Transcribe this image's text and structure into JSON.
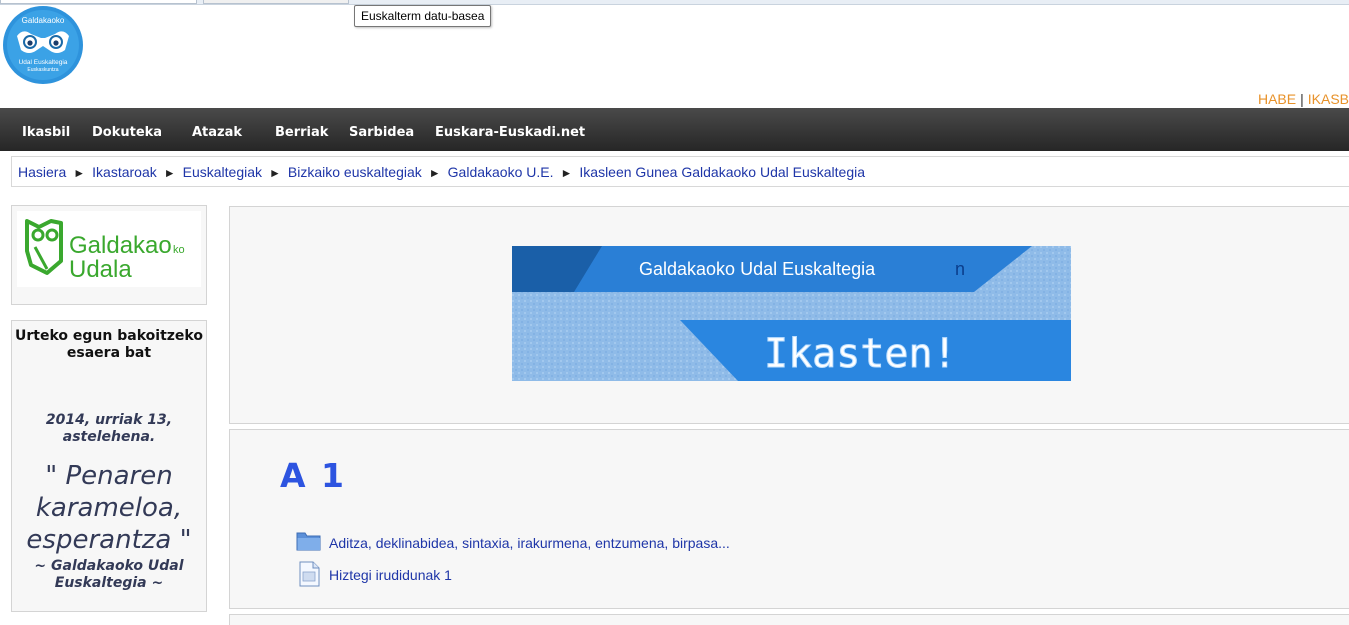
{
  "tooltip": "Euskalterm datu-basea",
  "logo": {
    "lines": [
      "Galdakaoko",
      "Udal Euskaltegia",
      "Euskaskuntza"
    ]
  },
  "top_links": [
    "HABE",
    "IKASB"
  ],
  "nav": [
    "Ikasbil",
    "Dokuteka",
    "Atazak",
    "Berriak",
    "Sarbidea",
    "Euskara-Euskadi.net"
  ],
  "breadcrumb": [
    "Hasiera",
    "Ikastaroak",
    "Euskaltegiak",
    "Bizkaiko euskaltegiak",
    "Galdakaoko U.E.",
    "Ikasleen Gunea Galdakaoko Udal Euskaltegia"
  ],
  "sidebar": {
    "town_logo": {
      "line1": "Galdakao",
      "suffix": "ko",
      "line2": "Udala"
    },
    "quote_block": {
      "title": "Urteko egun bakoitzeko esaera bat",
      "date": "2014, urriak 13, astelehena.",
      "quote": "\" Penaren karameloa, esperantza \"",
      "author": "~ Galdakaoko Udal Euskaltegia ~"
    }
  },
  "banner": {
    "line1": "Galdakaoko Udal Euskaltegia",
    "line1_extra": "n",
    "line2": "Ikasten!"
  },
  "course": {
    "title": "A 1",
    "resources": [
      {
        "icon": "folder-icon",
        "label": "Aditza, deklinabidea, sintaxia, irakurmena, entzumena, birpasa..."
      },
      {
        "icon": "document-icon",
        "label": "Hiztegi irudidunak 1"
      }
    ]
  },
  "colors": {
    "nav_bg": "#2d2d2d",
    "link": "#1f36a8",
    "course_title": "#2d54e0",
    "town_green": "#3aa82e",
    "top_link": "#e8922a"
  }
}
